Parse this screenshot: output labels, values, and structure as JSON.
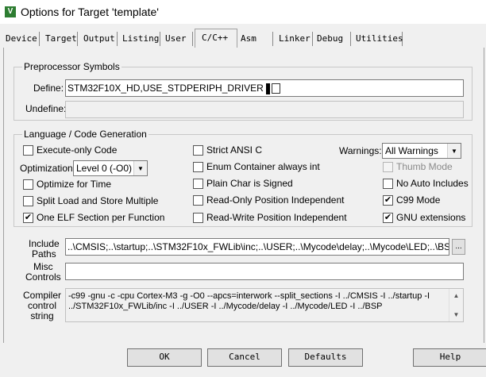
{
  "window": {
    "title": "Options for Target 'template'",
    "icon": "keil-app-icon",
    "icon_glyph": "V"
  },
  "tabs": [
    "Device",
    "Target",
    "Output",
    "Listing",
    "User",
    "C/C++",
    "Asm",
    "Linker",
    "Debug",
    "Utilities"
  ],
  "active_tab": "C/C++",
  "preprocessor": {
    "group_title": "Preprocessor Symbols",
    "define_label": "Define:",
    "define_value": "STM32F10X_HD,USE_STDPERIPH_DRIVER",
    "undefine_label": "Undefine:",
    "undefine_value": ""
  },
  "language": {
    "group_title": "Language / Code Generation",
    "execute_only": {
      "label": "Execute-only Code",
      "checked": false
    },
    "optimization_label": "Optimization:",
    "optimization_value": "Level 0 (-O0)",
    "optimize_time": {
      "label": "Optimize for Time",
      "checked": false
    },
    "split_load": {
      "label": "Split Load and Store Multiple",
      "checked": false
    },
    "one_elf": {
      "label": "One ELF Section per Function",
      "checked": true
    },
    "strict_ansi": {
      "label": "Strict ANSI C",
      "checked": false
    },
    "enum_container": {
      "label": "Enum Container always int",
      "checked": false
    },
    "plain_char": {
      "label": "Plain Char is Signed",
      "checked": false
    },
    "ro_pi": {
      "label": "Read-Only Position Independent",
      "checked": false
    },
    "rw_pi": {
      "label": "Read-Write Position Independent",
      "checked": false
    },
    "warnings_label": "Warnings:",
    "warnings_value": "All Warnings",
    "thumb_mode": {
      "label": "Thumb Mode",
      "checked": false,
      "disabled": true
    },
    "no_auto_includes": {
      "label": "No Auto Includes",
      "checked": false
    },
    "c99_mode": {
      "label": "C99 Mode",
      "checked": true
    },
    "gnu_extensions": {
      "label": "GNU extensions",
      "checked": true
    }
  },
  "include": {
    "label_line1": "Include",
    "label_line2": "Paths",
    "value": "..\\CMSIS;..\\startup;..\\STM32F10x_FWLib\\inc;..\\USER;..\\Mycode\\delay;..\\Mycode\\LED;..\\BSP",
    "browse_label": "..."
  },
  "misc": {
    "label_line1": "Misc",
    "label_line2": "Controls",
    "value": ""
  },
  "compiler": {
    "label_line1": "Compiler",
    "label_line2": "control",
    "label_line3": "string",
    "line1": "-c99 -gnu -c -cpu Cortex-M3 -g -O0 --apcs=interwork --split_sections -I ../CMSIS -I ../startup -I",
    "line2": "../STM32F10x_FWLib/inc -I ../USER -I ../Mycode/delay -I ../Mycode/LED -I ../BSP"
  },
  "buttons": {
    "ok": "OK",
    "cancel": "Cancel",
    "defaults": "Defaults",
    "help": "Help"
  },
  "checkmark": "✔"
}
